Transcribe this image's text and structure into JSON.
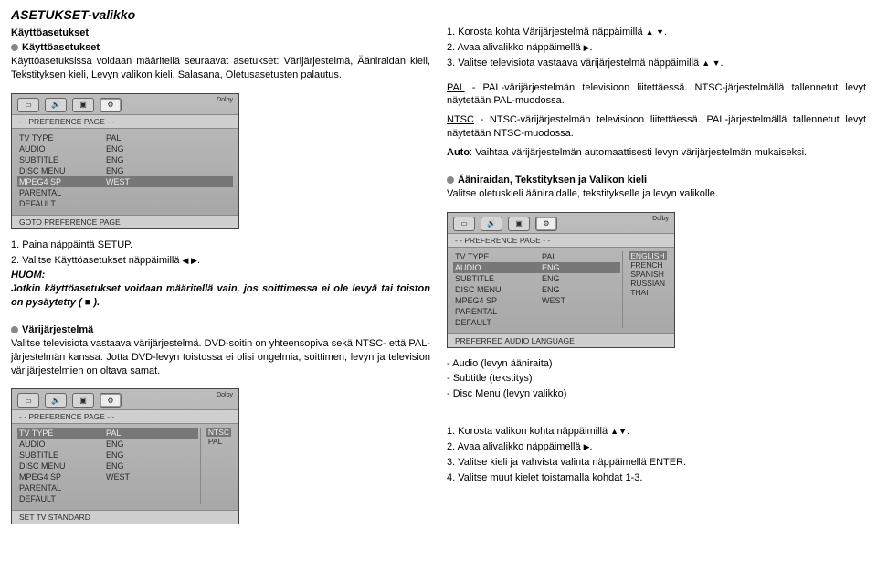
{
  "title": "ASETUKSET-valikko",
  "left": {
    "h1": "Käyttöasetukset",
    "h2": "Käyttöasetukset",
    "intro": "Käyttöasetuksissa voidaan määritellä seuraavat asetukset: Värijärjestelmä, Ääniraidan kieli, Tekstityksen kieli, Levyn valikon kieli, Salasana, Oletusasetusten palautus.",
    "step1": "1. Paina näppäintä SETUP.",
    "step2a": "2. Valitse Käyttöasetukset näppäimillä ",
    "step2b": ".",
    "note_label": "HUOM:",
    "note_body": "Jotkin käyttöasetukset voidaan määritellä vain, jos soittimessa ei ole levyä tai toiston on pysäytetty (   ).",
    "h3": "Värijärjestelmä",
    "body_tv": "Valitse televisiota vastaava värijärjestelmä. DVD-soitin on yhteensopiva sekä NTSC- että PAL-järjestelmän kanssa. Jotta DVD-levyn toistossa ei olisi ongelmia, soittimen, levyn ja television värijärjestelmien on oltava samat."
  },
  "right": {
    "step1a": "1. Korosta kohta Värijärjestelmä näppäimillä ",
    "step1b": ".",
    "step2a": "2. Avaa alivalikko näppäimellä ",
    "step2b": ".",
    "step3a": "3. Valitse televisiota vastaava värijärjestelmä näppäimillä ",
    "step3b": ".",
    "pal_label": "PAL",
    "pal_text": " - PAL-värijärjestelmän televisioon liitettäessä. NTSC-järjestelmällä tallennetut levyt näytetään PAL-muodossa.",
    "ntsc_label": "NTSC",
    "ntsc_text": " - NTSC-värijärjestelmän televisioon liitettäessä. PAL-järjestelmällä tallennetut levyt näytetään NTSC-muodossa.",
    "auto_label": "Auto",
    "auto_text": ": Vaihtaa värijärjestelmän automaattisesti levyn värijärjestelmän mukaiseksi.",
    "h4": "Ääniraidan, Tekstityksen ja Valikon kieli",
    "body_lang": "Valitse oletuskieli ääniraidalle, tekstitykselle ja levyn valikolle.",
    "bullets": {
      "a": "- Audio (levyn ääniraita)",
      "b": "- Subtitle (tekstitys)",
      "c": "- Disc Menu (levyn valikko)"
    },
    "k_step1a": "1. Korosta valikon kohta näppäimillä ",
    "k_step1b": ".",
    "k_step2a": "2. Avaa alivalikko näppäimellä ",
    "k_step2b": ".",
    "k_step3": "3. Valitse kieli ja vahvista valinta näppäimellä ENTER.",
    "k_step4": "4. Valitse muut kielet toistamalla kohdat 1-3."
  },
  "shot1": {
    "head": "- -  PREFERENCE PAGE  - -",
    "rows": [
      {
        "l": "TV TYPE",
        "v": "PAL"
      },
      {
        "l": "AUDIO",
        "v": "ENG"
      },
      {
        "l": "SUBTITLE",
        "v": "ENG"
      },
      {
        "l": "DISC MENU",
        "v": "ENG"
      },
      {
        "l": "MPEG4 SP",
        "v": "WEST",
        "hl": true
      },
      {
        "l": "PARENTAL",
        "v": ""
      },
      {
        "l": "DEFAULT",
        "v": ""
      }
    ],
    "footer": "GOTO PREFERENCE PAGE"
  },
  "shot2": {
    "head": "- -  PREFERENCE PAGE  - -",
    "rows": [
      {
        "l": "TV TYPE",
        "v": "PAL",
        "opt": "NTSC",
        "hl": true
      },
      {
        "l": "AUDIO",
        "v": "ENG",
        "opt": "PAL"
      },
      {
        "l": "SUBTITLE",
        "v": "ENG"
      },
      {
        "l": "DISC MENU",
        "v": "ENG"
      },
      {
        "l": "MPEG4 SP",
        "v": "WEST"
      },
      {
        "l": "PARENTAL",
        "v": ""
      },
      {
        "l": "DEFAULT",
        "v": ""
      }
    ],
    "footer": "SET TV STANDARD"
  },
  "shot3": {
    "head": "- -  PREFERENCE PAGE  - -",
    "rows_main": [
      {
        "l": "TV TYPE",
        "v": "PAL"
      },
      {
        "l": "AUDIO",
        "v": "ENG",
        "hl": true
      },
      {
        "l": "SUBTITLE",
        "v": "ENG"
      },
      {
        "l": "DISC MENU",
        "v": "ENG"
      },
      {
        "l": "MPEG4 SP",
        "v": "WEST"
      },
      {
        "l": "PARENTAL",
        "v": ""
      },
      {
        "l": "DEFAULT",
        "v": ""
      }
    ],
    "opts": [
      "ENGLISH",
      "FRENCH",
      "SPANISH",
      "RUSSIAN",
      "THAI"
    ],
    "footer": "PREFERRED AUDIO LANGUAGE"
  },
  "dolby": "Dolby"
}
